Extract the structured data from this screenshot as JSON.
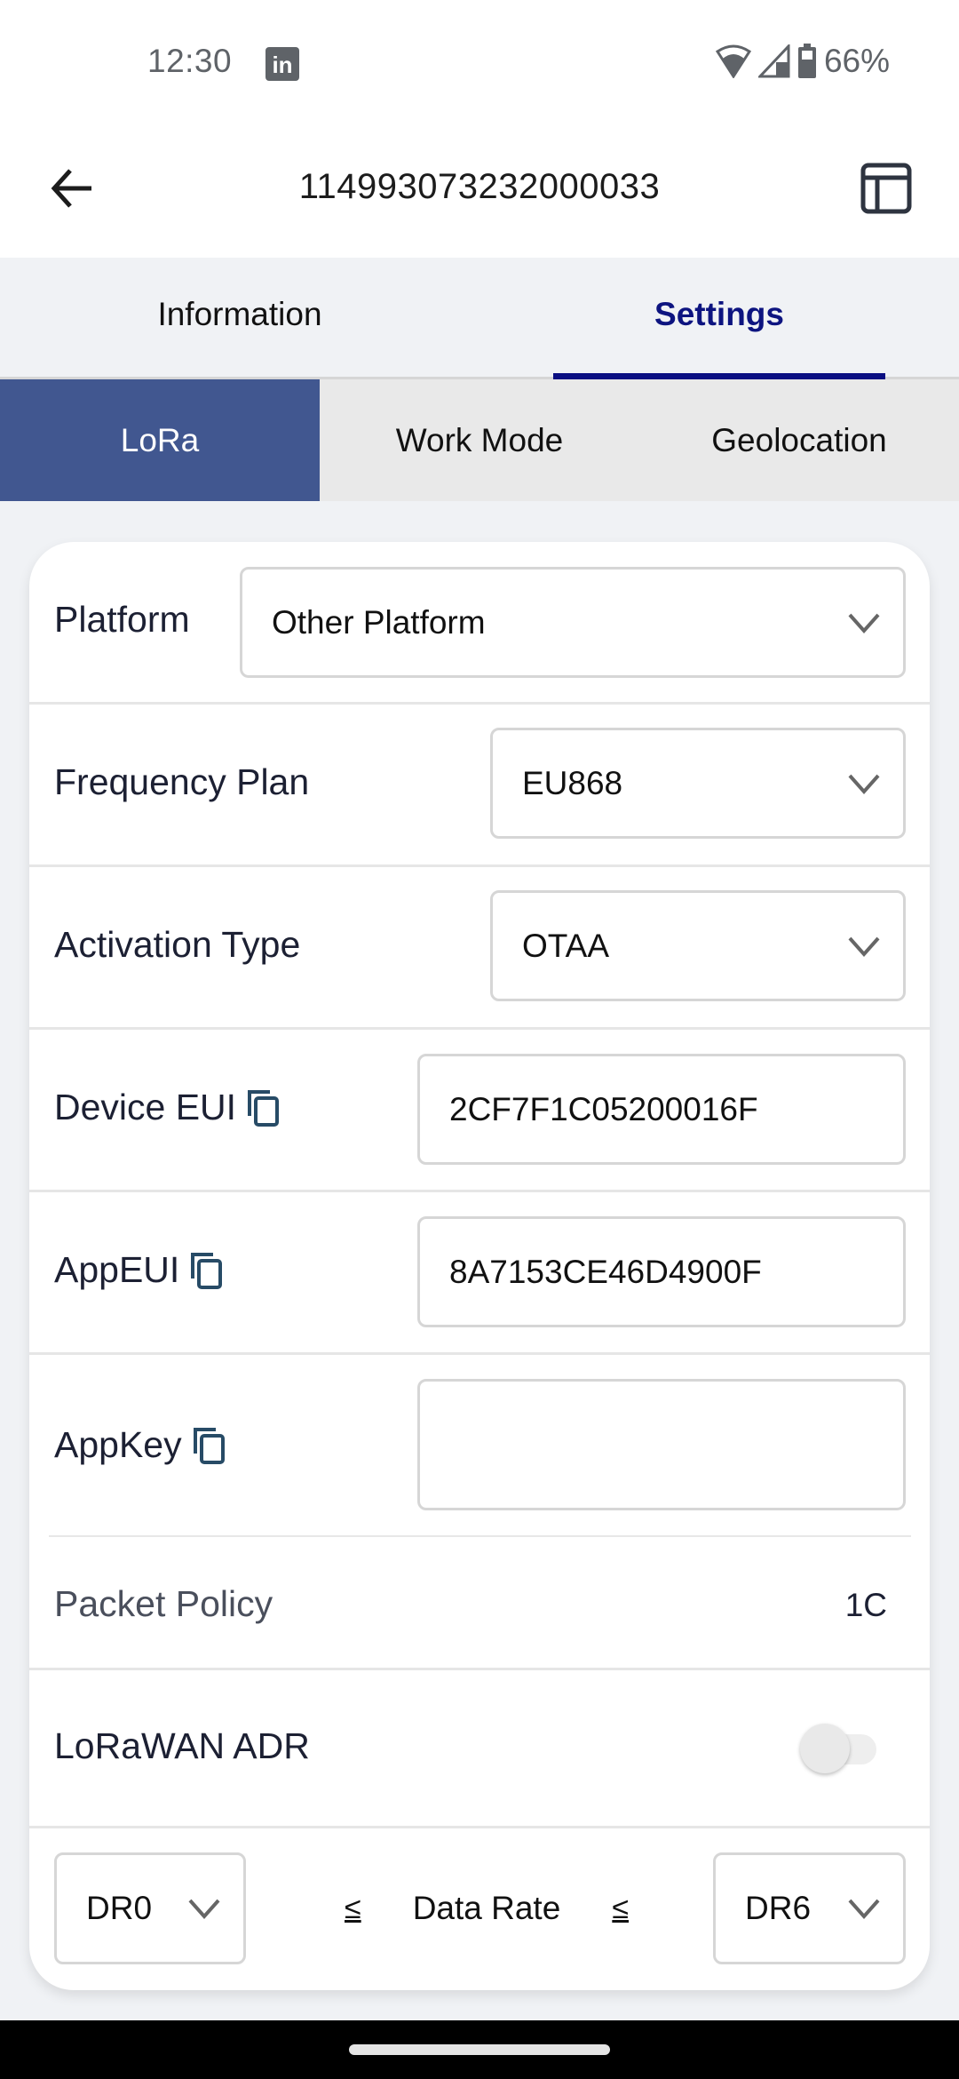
{
  "status_bar": {
    "time": "12:30",
    "notification_icon": "linkedin-icon",
    "wifi_icon": "wifi-icon",
    "signal_icon": "cell-signal-icon",
    "battery_icon": "battery-icon",
    "battery_percent": "66%"
  },
  "app_bar": {
    "back_icon": "arrow-left-icon",
    "title": "114993073232000033",
    "layout_icon": "layout-icon"
  },
  "main_tabs": [
    {
      "label": "Information",
      "active": false
    },
    {
      "label": "Settings",
      "active": true
    }
  ],
  "sub_tabs": [
    {
      "label": "LoRa",
      "active": true
    },
    {
      "label": "Work Mode",
      "active": false
    },
    {
      "label": "Geolocation",
      "active": false
    }
  ],
  "form": {
    "platform": {
      "label": "Platform",
      "value": "Other Platform"
    },
    "frequency_plan": {
      "label": "Frequency Plan",
      "value": "EU868"
    },
    "activation_type": {
      "label": "Activation Type",
      "value": "OTAA"
    },
    "device_eui": {
      "label": "Device EUI",
      "value": "2CF7F1C05200016F"
    },
    "app_eui": {
      "label": "AppEUI",
      "value": "8A7153CE46D4900F"
    },
    "app_key": {
      "label": "AppKey",
      "value": ""
    },
    "packet_policy": {
      "label": "Packet Policy",
      "value": "1C"
    },
    "lorawan_adr": {
      "label": "LoRaWAN ADR",
      "enabled": false
    },
    "data_rate": {
      "min": "DR0",
      "label": "Data Rate",
      "le_symbol": "≤",
      "max": "DR6"
    }
  },
  "colors": {
    "active_subtab_bg": "#415790",
    "active_tab_text": "#0d1480",
    "tab_indicator": "#0a0f82",
    "copy_icon": "#274b66"
  }
}
